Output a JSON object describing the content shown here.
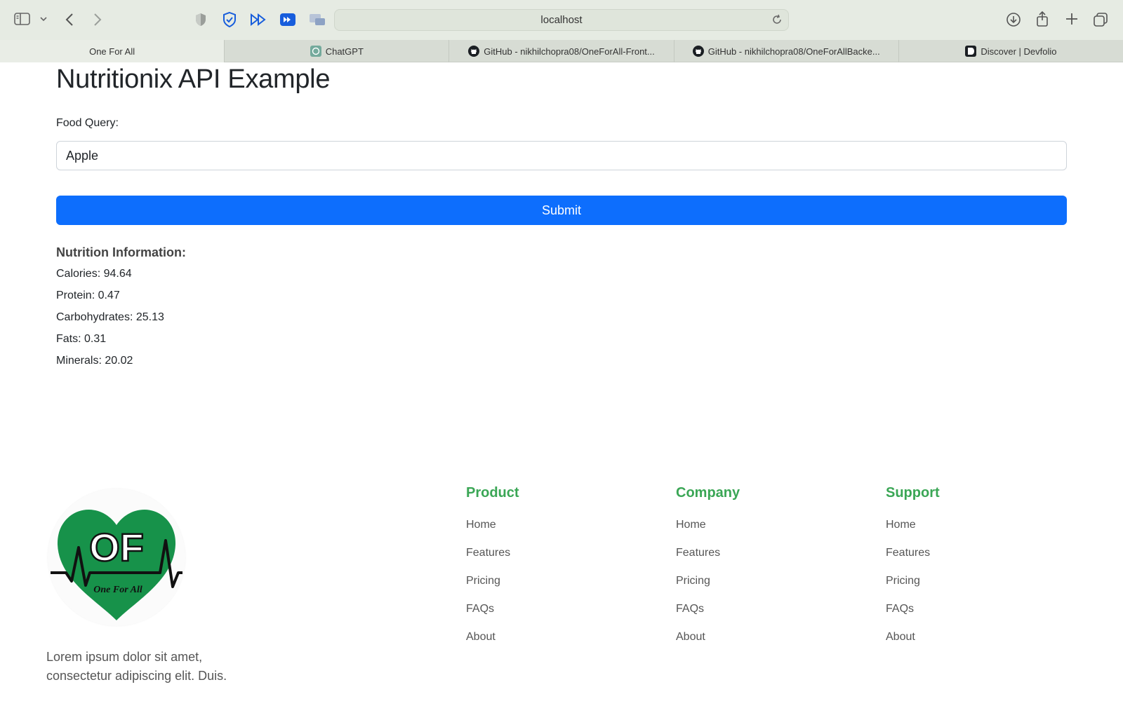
{
  "browser": {
    "url": "localhost",
    "tabs": [
      {
        "label": "One For All",
        "icon": "none"
      },
      {
        "label": "ChatGPT",
        "icon": "chatgpt-icon"
      },
      {
        "label": "GitHub - nikhilchopra08/OneForAll-Front...",
        "icon": "github-icon"
      },
      {
        "label": "GitHub - nikhilchopra08/OneForAllBacke...",
        "icon": "github-icon"
      },
      {
        "label": "Discover | Devfolio",
        "icon": "devfolio-icon"
      }
    ]
  },
  "main": {
    "title": "Nutritionix API Example",
    "food_label": "Food Query:",
    "food_value": "Apple",
    "submit_label": "Submit",
    "nutrition_heading": "Nutrition Information:",
    "nutrition": [
      "Calories: 94.64",
      "Protein: 0.47",
      "Carbohydrates: 25.13",
      "Fats: 0.31",
      "Minerals: 20.02"
    ]
  },
  "footer": {
    "logo_text": "OF",
    "logo_tagline": "One For All",
    "blurb": "Lorem ipsum dolor sit amet, consectetur adipiscing elit. Duis.",
    "columns": [
      {
        "title": "Product",
        "links": [
          "Home",
          "Features",
          "Pricing",
          "FAQs",
          "About"
        ]
      },
      {
        "title": "Company",
        "links": [
          "Home",
          "Features",
          "Pricing",
          "FAQs",
          "About"
        ]
      },
      {
        "title": "Support",
        "links": [
          "Home",
          "Features",
          "Pricing",
          "FAQs",
          "About"
        ]
      }
    ]
  },
  "colors": {
    "accent_blue": "#0d6efd",
    "brand_green": "#3aa655",
    "logo_green": "#17924a"
  }
}
